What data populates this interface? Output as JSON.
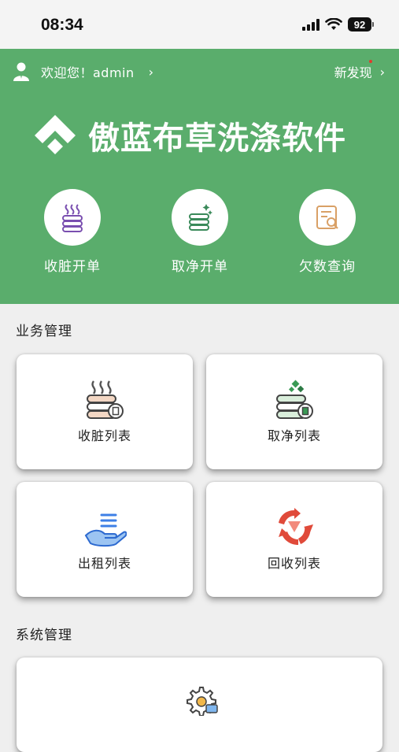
{
  "status_bar": {
    "time": "08:34",
    "battery": "92"
  },
  "header": {
    "welcome": "欢迎您！admin",
    "discover": "新发现",
    "brand": "傲蓝布草洗涤软件",
    "quick_actions": [
      {
        "label": "收脏开单",
        "icon": "dirty-linen-icon"
      },
      {
        "label": "取净开单",
        "icon": "clean-linen-icon"
      },
      {
        "label": "欠数查询",
        "icon": "search-document-icon"
      }
    ]
  },
  "business": {
    "title": "业务管理",
    "cards": [
      {
        "label": "收脏列表",
        "icon": "dirty-list-icon"
      },
      {
        "label": "取净列表",
        "icon": "clean-list-icon"
      },
      {
        "label": "出租列表",
        "icon": "rent-list-icon"
      },
      {
        "label": "回收列表",
        "icon": "recycle-list-icon"
      }
    ]
  },
  "system": {
    "title": "系统管理",
    "cards": [
      {
        "icon": "settings-gear-icon"
      }
    ]
  },
  "colors": {
    "header_green": "#5aad6c",
    "accent_purple": "#7a4fb0",
    "accent_red": "#e04a3a",
    "accent_blue": "#3d7fe6"
  }
}
